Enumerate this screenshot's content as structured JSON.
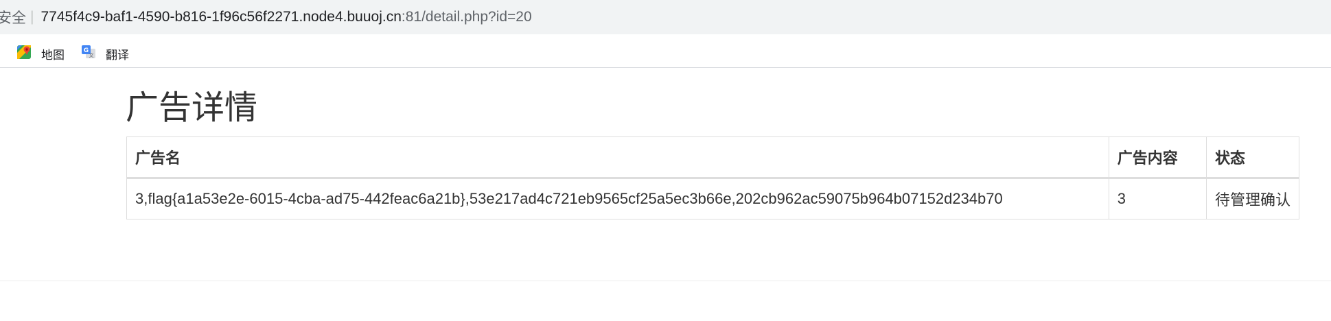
{
  "browser": {
    "security_label": "安全",
    "separator": "|",
    "url_host": "7745f4c9-baf1-4590-b816-1f96c56f2271.node4.buuoj.cn",
    "url_path": ":81/detail.php?id=20"
  },
  "bookmarks": [
    {
      "label": "地图",
      "icon": "maps-icon"
    },
    {
      "label": "翻译",
      "icon": "translate-icon"
    }
  ],
  "page": {
    "title": "广告详情"
  },
  "table": {
    "headers": [
      "广告名",
      "广告内容",
      "状态"
    ],
    "rows": [
      [
        "3,flag{a1a53e2e-6015-4cba-ad75-442feac6a21b},53e217ad4c721eb9565cf25a5ec3b66e,202cb962ac59075b964b07152d234b70",
        "3",
        "待管理确认"
      ]
    ]
  }
}
